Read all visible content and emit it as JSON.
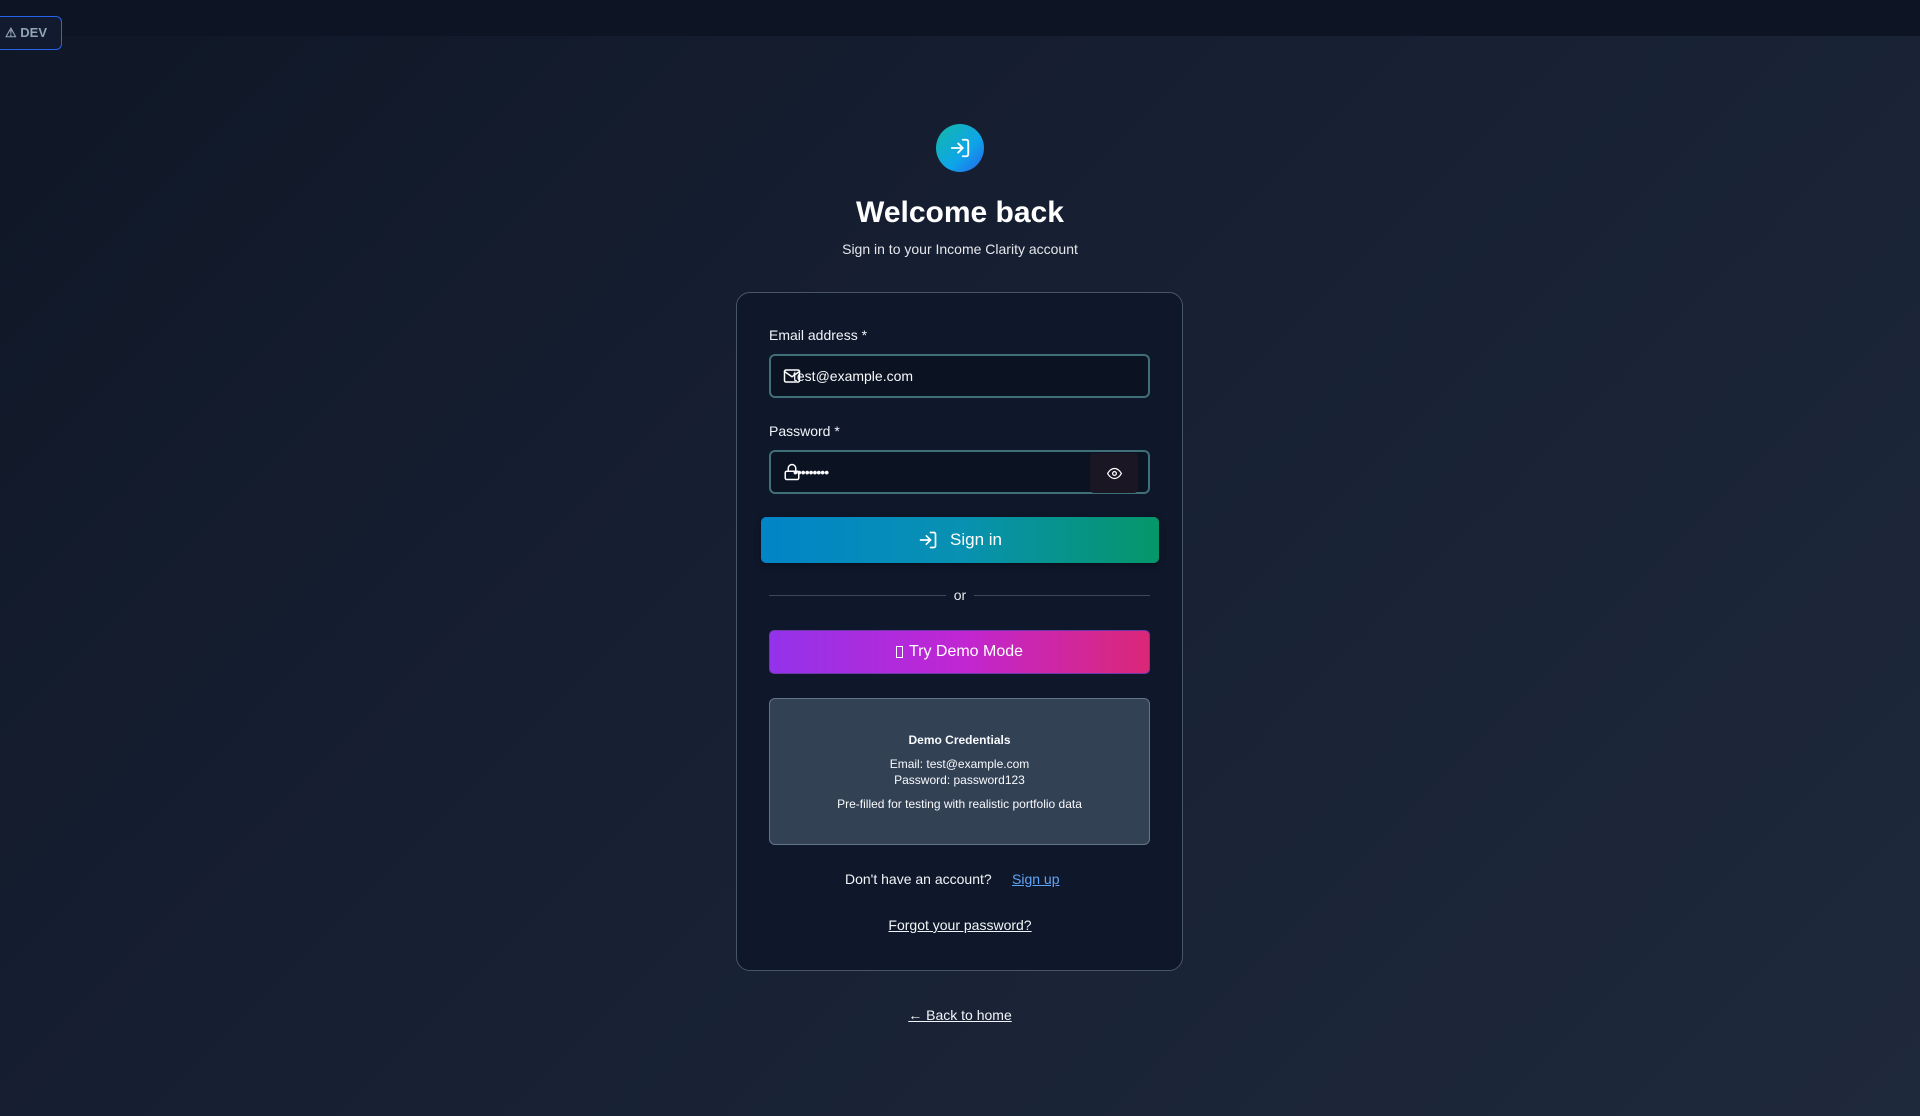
{
  "dev_badge": {
    "label": "⚠ DEV"
  },
  "header": {
    "logo_icon": "sign-in-icon",
    "title": "Welcome back",
    "subtitle": "Sign in to your Income Clarity account"
  },
  "form": {
    "email_label": "Email address *",
    "email_value": "test@example.com",
    "email_icon": "mail-icon",
    "password_label": "Password *",
    "password_value": "•••••••••",
    "password_icon": "lock-icon",
    "show_password_icon": "eye-icon",
    "signin_label": "Sign in",
    "signin_icon": "sign-in-icon",
    "or_text": "or",
    "demo_label": "Try Demo Mode"
  },
  "demo_credentials": {
    "title": "Demo Credentials",
    "email_line": "Email: test@example.com",
    "password_line": "Password: password123",
    "note": "Pre-filled for testing with realistic portfolio data"
  },
  "footer": {
    "no_account_text": "Don't have an account?",
    "signup_label": "Sign up",
    "forgot_label": "Forgot your password?",
    "back_label": "← Back to home"
  },
  "colors": {
    "background": "#172033",
    "card": "#0f172a",
    "signin_gradient_start": "#0284c7",
    "signin_gradient_end": "#059669",
    "demo_gradient_start": "#9333ea",
    "demo_gradient_end": "#db2777",
    "link": "#60a5fa"
  }
}
